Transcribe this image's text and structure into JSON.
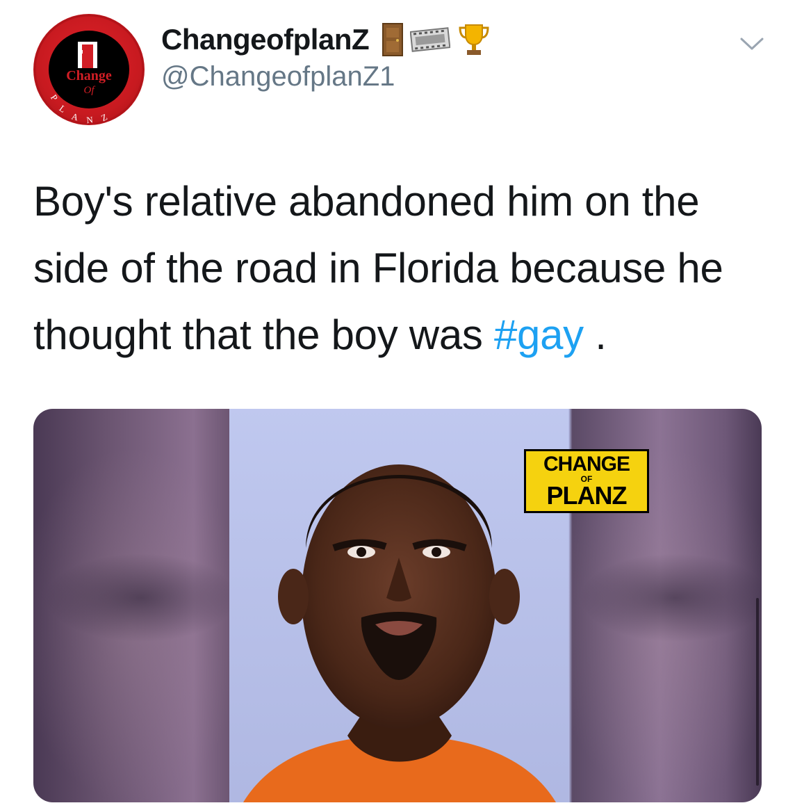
{
  "tweet": {
    "display_name": "ChangeofplanZ",
    "name_emojis": [
      "door-icon",
      "film-icon",
      "trophy-icon"
    ],
    "handle": "@ChangeofplanZ1",
    "avatar": {
      "line1": "Change",
      "line2": "Of",
      "line3": "PLANZ"
    },
    "text_main": "Boy's relative abandoned him on the side of the road in Florida because he thought that the boy was",
    "hashtag": "#gay",
    "text_end": " .",
    "media": {
      "watermark": {
        "line1": "CHANGE",
        "line2": "OF",
        "line3": "PLANZ"
      }
    }
  },
  "colors": {
    "text": "#14171a",
    "secondary": "#657786",
    "link": "#1da1f2",
    "brand_red": "#d11e25",
    "brand_yellow": "#f5d20f"
  }
}
